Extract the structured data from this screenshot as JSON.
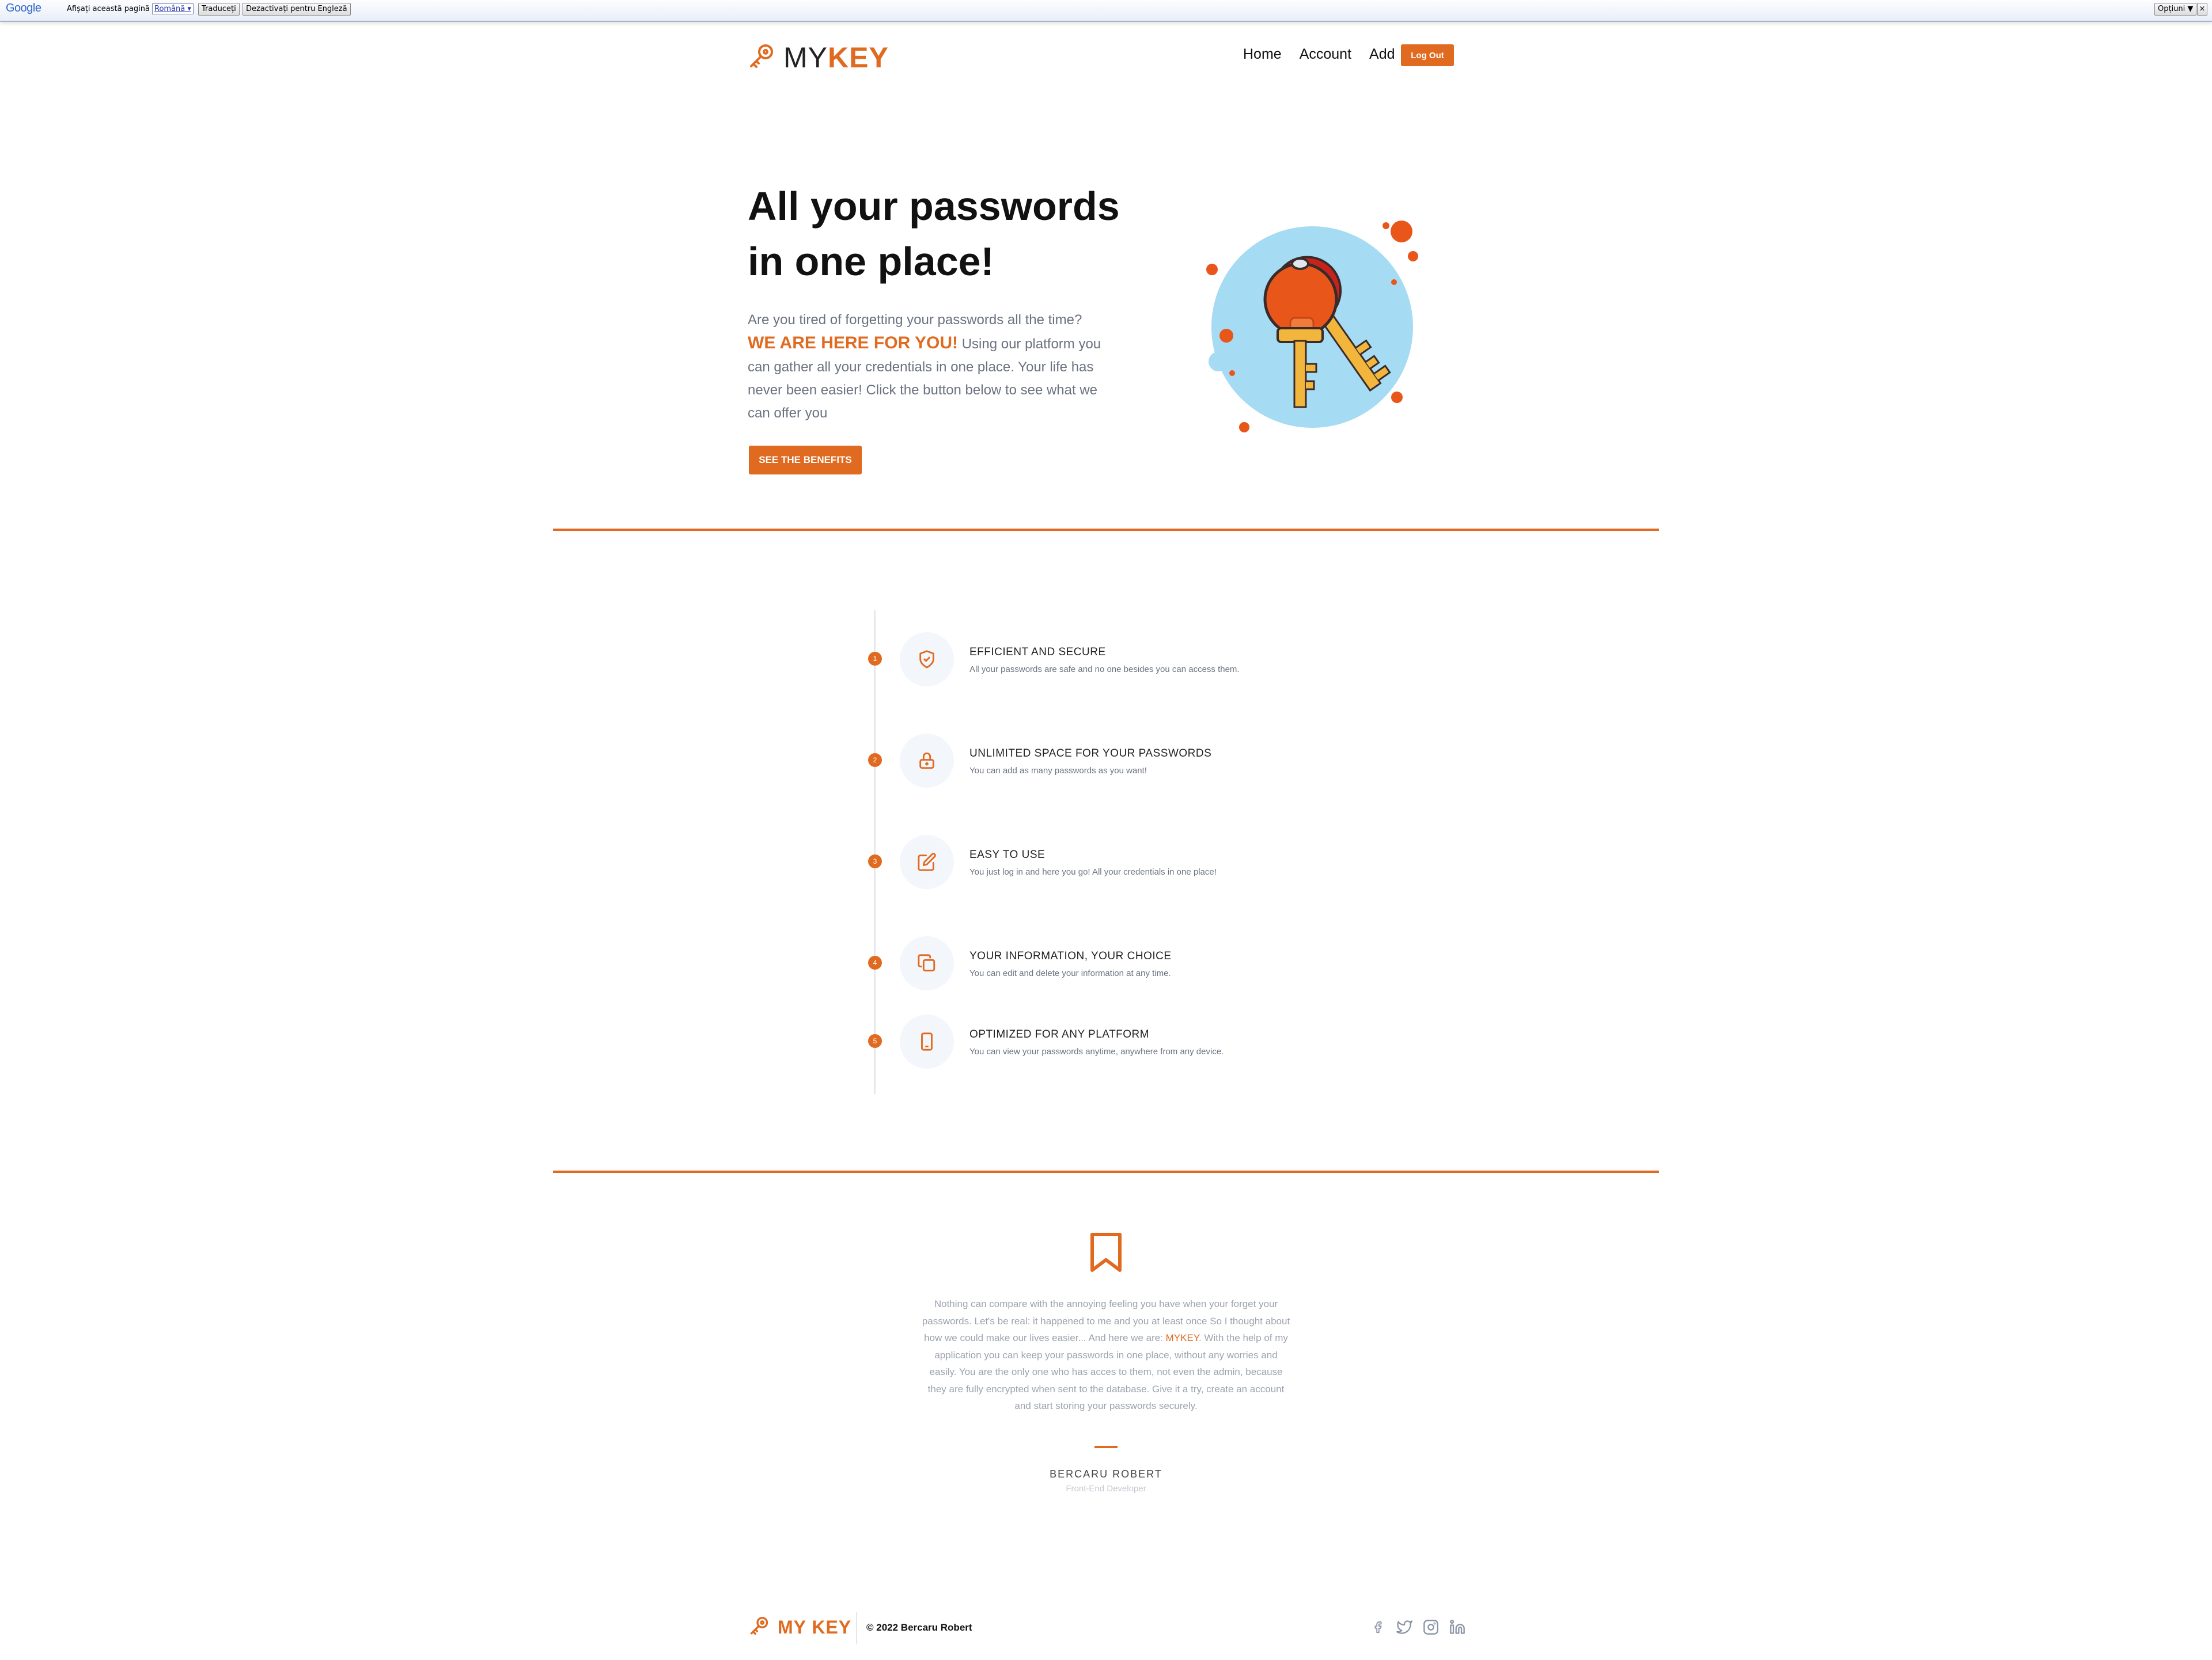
{
  "translate_bar": {
    "logo": "Google",
    "prompt": "Afișați această pagină în",
    "language": "Română ▾",
    "translate_button": "Traduceți",
    "disable_button": "Dezactivați pentru Engleză",
    "options": "Opțiuni ▼",
    "close": "×"
  },
  "brand": {
    "prefix": "MY",
    "suffix": "KEY",
    "accent": "#e06a1f"
  },
  "nav": {
    "home": "Home",
    "account": "Account",
    "add": "Add",
    "logout": "Log Out"
  },
  "hero": {
    "title_line1": "All your passwords",
    "title_line2": "in one place!",
    "text_before": "Are you tired of forgetting your passwords all the time? ",
    "highlight": "WE ARE HERE FOR YOU!",
    "text_after": " Using our platform you can gather all your credentials in one place. Your life has never been easier! Click the button below to see what we can offer you",
    "cta": "SEE THE BENEFITS"
  },
  "features": [
    {
      "num": "1",
      "icon": "shield-check-icon",
      "title": "EFFICIENT AND SECURE",
      "desc": "All your passwords are safe and no one besides you can access them."
    },
    {
      "num": "2",
      "icon": "lock-icon",
      "title": "UNLIMITED SPACE FOR YOUR PASSWORDS",
      "desc": "You can add as many passwords as you want!"
    },
    {
      "num": "3",
      "icon": "edit-icon",
      "title": "EASY TO USE",
      "desc": "You just log in and here you go! All your credentials in one place!"
    },
    {
      "num": "4",
      "icon": "copy-icon",
      "title": "YOUR INFORMATION, YOUR CHOICE",
      "desc": "You can edit and delete your information at any time."
    },
    {
      "num": "5",
      "icon": "mobile-icon",
      "title": "OPTIMIZED FOR ANY PLATFORM",
      "desc": "You can view your passwords anytime, anywhere from any device."
    }
  ],
  "testimonial": {
    "text_before": "Nothing can compare with the annoying feeling you have when your forget your passwords. Let's be real: it happened to me and you at least once So I thought about how we could make our lives easier... And here we are: ",
    "brand": "MYKEY",
    "text_after": ". With the help of my application you can keep your passwords in one place, without any worries and easily. You are the only one who has acces to them, not even the admin, because they are fully encrypted when sent to the database. Give it a try, create an account and start storing your passwords securely.",
    "author": "BERCARU ROBERT",
    "role": "Front-End Developer"
  },
  "footer": {
    "logo": "MY KEY",
    "copyright": "© 2022 Bercaru Robert",
    "social": [
      "facebook-icon",
      "twitter-icon",
      "instagram-icon",
      "linkedin-icon"
    ]
  }
}
